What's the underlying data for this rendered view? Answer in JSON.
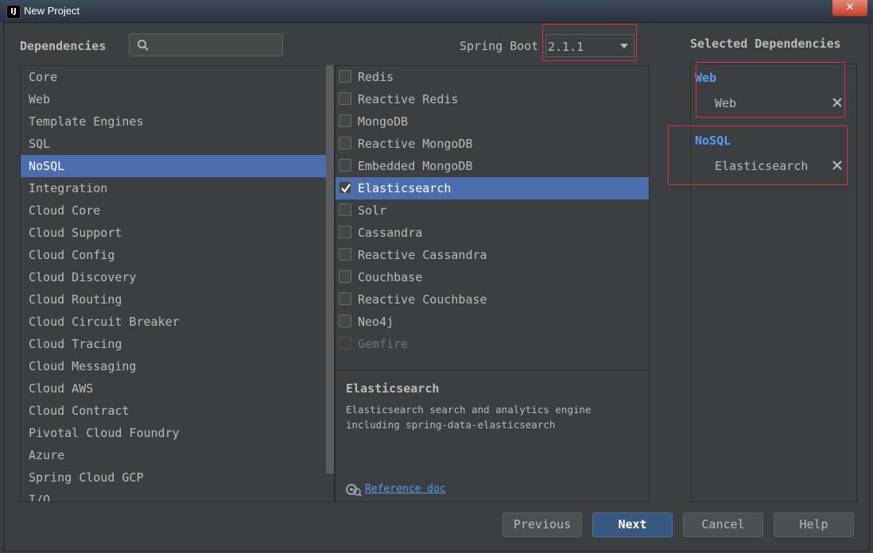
{
  "window": {
    "title": "New Project",
    "app_icon": "IJ",
    "close_glyph": "✕"
  },
  "header": {
    "dependencies_label": "Dependencies",
    "search_value": "",
    "spring_boot_label": "Spring Boot",
    "spring_boot_version": "2.1.1",
    "selected_title": "Selected Dependencies"
  },
  "categories": [
    "Core",
    "Web",
    "Template Engines",
    "SQL",
    "NoSQL",
    "Integration",
    "Cloud Core",
    "Cloud Support",
    "Cloud Config",
    "Cloud Discovery",
    "Cloud Routing",
    "Cloud Circuit Breaker",
    "Cloud Tracing",
    "Cloud Messaging",
    "Cloud AWS",
    "Cloud Contract",
    "Pivotal Cloud Foundry",
    "Azure",
    "Spring Cloud GCP",
    "I/O"
  ],
  "selected_category": "NoSQL",
  "dependencies": [
    {
      "label": "Redis",
      "checked": false,
      "enabled": true
    },
    {
      "label": "Reactive Redis",
      "checked": false,
      "enabled": true
    },
    {
      "label": "MongoDB",
      "checked": false,
      "enabled": true
    },
    {
      "label": "Reactive MongoDB",
      "checked": false,
      "enabled": true
    },
    {
      "label": "Embedded MongoDB",
      "checked": false,
      "enabled": true
    },
    {
      "label": "Elasticsearch",
      "checked": true,
      "enabled": true,
      "selected": true
    },
    {
      "label": "Solr",
      "checked": false,
      "enabled": true
    },
    {
      "label": "Cassandra",
      "checked": false,
      "enabled": true
    },
    {
      "label": "Reactive Cassandra",
      "checked": false,
      "enabled": true
    },
    {
      "label": "Couchbase",
      "checked": false,
      "enabled": true
    },
    {
      "label": "Reactive Couchbase",
      "checked": false,
      "enabled": true
    },
    {
      "label": "Neo4j",
      "checked": false,
      "enabled": true
    },
    {
      "label": "Gemfire",
      "checked": false,
      "enabled": false
    }
  ],
  "description": {
    "title": "Elasticsearch",
    "text": "Elasticsearch search and analytics engine including spring-data-elasticsearch",
    "link": "Reference doc"
  },
  "selected": [
    {
      "group": "Web",
      "items": [
        "Web"
      ]
    },
    {
      "group": "NoSQL",
      "items": [
        "Elasticsearch"
      ]
    }
  ],
  "buttons": {
    "previous": "Previous",
    "next": "Next",
    "cancel": "Cancel",
    "help": "Help"
  },
  "colors": {
    "background": "#3c3f41",
    "selection": "#4b6eaf",
    "accent": "#589df6",
    "highlight_box": "#e03030"
  }
}
